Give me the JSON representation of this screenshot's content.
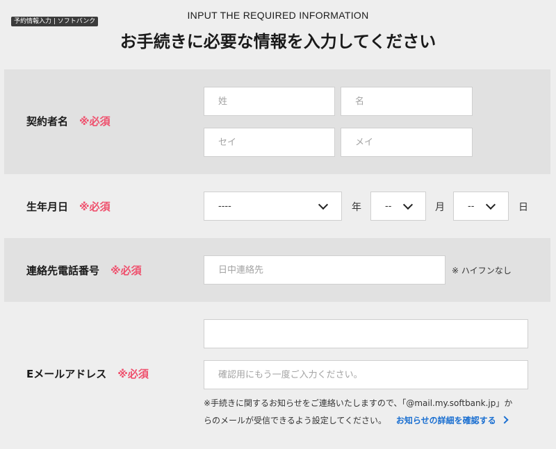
{
  "tooltip": "予約情報入力 | ソフトバンク",
  "header": {
    "eyebrow": "INPUT THE REQUIRED INFORMATION",
    "title": "お手続きに必要な情報を入力してください"
  },
  "required_badge": "※必須",
  "contract_name": {
    "label": "契約者名",
    "last_name_placeholder": "姓",
    "first_name_placeholder": "名",
    "last_kana_placeholder": "セイ",
    "first_kana_placeholder": "メイ"
  },
  "birthdate": {
    "label": "生年月日",
    "year_value": "----",
    "year_unit": "年",
    "month_value": "--",
    "month_unit": "月",
    "day_value": "--",
    "day_unit": "日"
  },
  "phone": {
    "label": "連絡先電話番号",
    "placeholder": "日中連絡先",
    "note": "※ ハイフンなし"
  },
  "email": {
    "label": "Eメールアドレス",
    "placeholder": "",
    "confirm_placeholder": "確認用にもう一度ご入力ください。",
    "note_line1": "※手続きに関するお知らせをご連絡いたしますので、「@mail.my.softbank.jp」か",
    "note_line2": "らのメールが受信できるよう設定してください。",
    "link_text": "お知らせの詳細を確認する"
  },
  "colors": {
    "required": "#ef4f6c",
    "link": "#1a6fd1",
    "shaded_row": "#e1e1e1",
    "page_bg": "#eeeeee"
  }
}
